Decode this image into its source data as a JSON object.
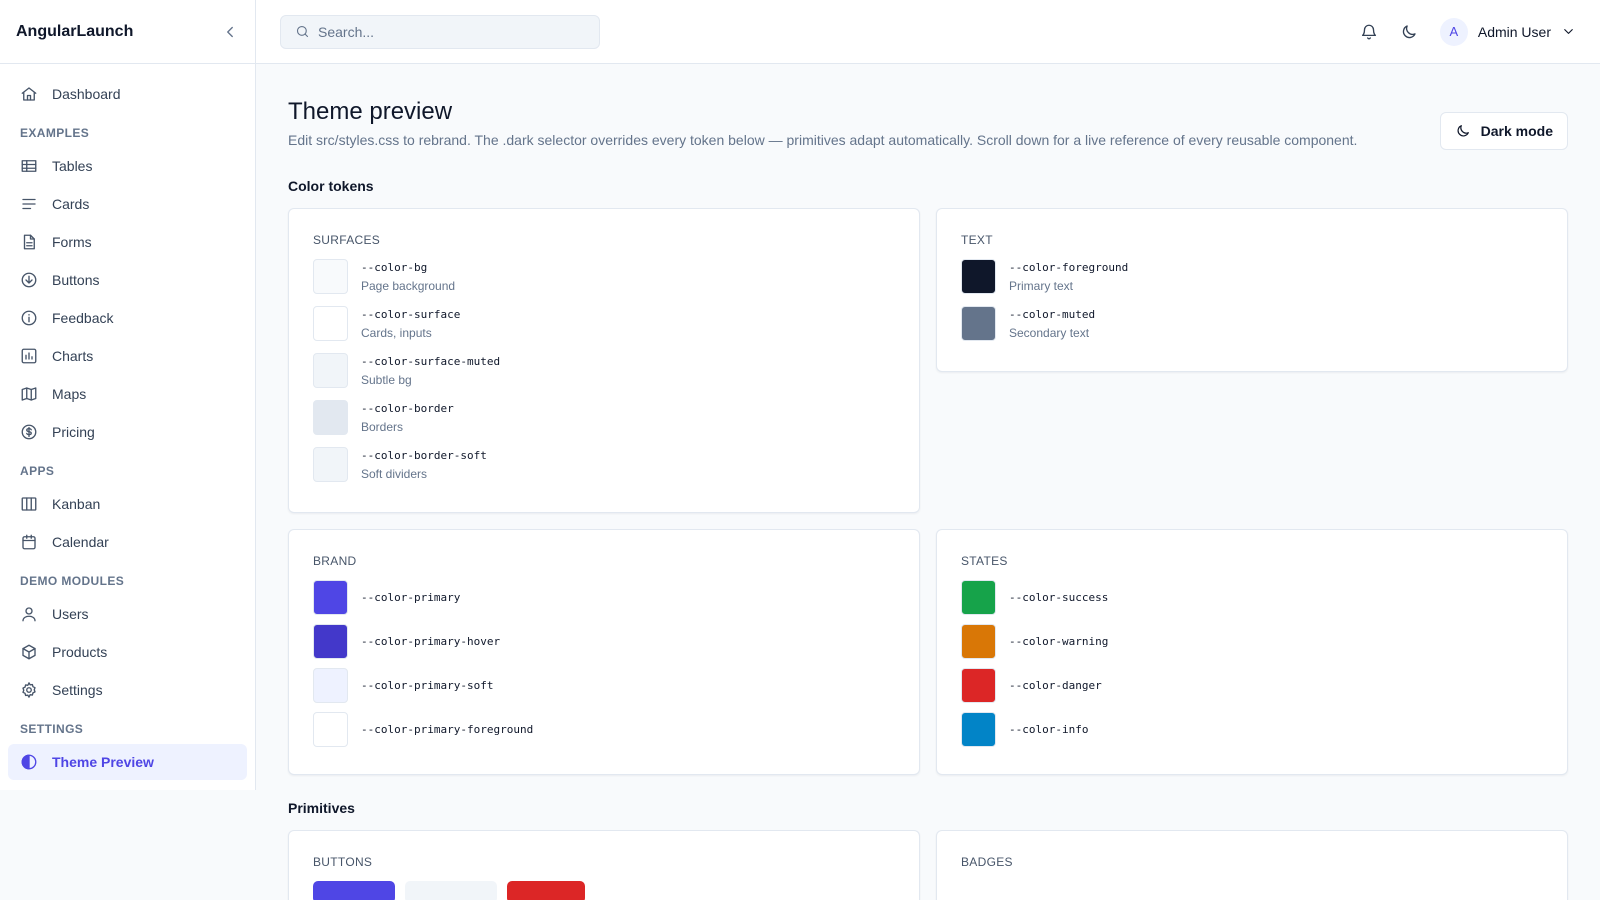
{
  "app": {
    "name": "AngularLaunch"
  },
  "sidebar": {
    "items": [
      {
        "label": "Dashboard",
        "icon": "home-icon"
      }
    ],
    "sections": [
      {
        "title": "EXAMPLES",
        "items": [
          {
            "label": "Tables",
            "icon": "table-icon"
          },
          {
            "label": "Cards",
            "icon": "lines-icon"
          },
          {
            "label": "Forms",
            "icon": "file-icon"
          },
          {
            "label": "Buttons",
            "icon": "arrow-down-circle-icon"
          },
          {
            "label": "Feedback",
            "icon": "info-icon"
          },
          {
            "label": "Charts",
            "icon": "bar-chart-icon"
          },
          {
            "label": "Maps",
            "icon": "map-icon"
          },
          {
            "label": "Pricing",
            "icon": "dollar-icon"
          }
        ]
      },
      {
        "title": "APPS",
        "items": [
          {
            "label": "Kanban",
            "icon": "kanban-icon"
          },
          {
            "label": "Calendar",
            "icon": "calendar-icon"
          }
        ]
      },
      {
        "title": "DEMO MODULES",
        "items": [
          {
            "label": "Users",
            "icon": "user-icon"
          },
          {
            "label": "Products",
            "icon": "box-icon"
          },
          {
            "label": "Settings",
            "icon": "gear-icon"
          }
        ]
      },
      {
        "title": "SETTINGS",
        "items": [
          {
            "label": "Theme Preview",
            "icon": "contrast-icon",
            "active": true
          }
        ]
      }
    ]
  },
  "topbar": {
    "search_placeholder": "Search...",
    "user": {
      "initial": "A",
      "name": "Admin User"
    }
  },
  "page": {
    "title": "Theme preview",
    "description": "Edit src/styles.css to rebrand. The .dark selector overrides every token below — primitives adapt automatically. Scroll down for a live reference of every reusable component.",
    "dark_mode_label": "Dark mode"
  },
  "color_tokens": {
    "title": "Color tokens",
    "surfaces": {
      "title": "SURFACES",
      "tokens": [
        {
          "name": "--color-bg",
          "desc": "Page background",
          "color": "#f8fafc"
        },
        {
          "name": "--color-surface",
          "desc": "Cards, inputs",
          "color": "#ffffff"
        },
        {
          "name": "--color-surface-muted",
          "desc": "Subtle bg",
          "color": "#f1f5f9"
        },
        {
          "name": "--color-border",
          "desc": "Borders",
          "color": "#e2e8f0"
        },
        {
          "name": "--color-border-soft",
          "desc": "Soft dividers",
          "color": "#f1f5f9"
        }
      ]
    },
    "text": {
      "title": "TEXT",
      "tokens": [
        {
          "name": "--color-foreground",
          "desc": "Primary text",
          "color": "#0f172a"
        },
        {
          "name": "--color-muted",
          "desc": "Secondary text",
          "color": "#64748b"
        }
      ]
    },
    "brand": {
      "title": "BRAND",
      "tokens": [
        {
          "name": "--color-primary",
          "color": "#4f46e5"
        },
        {
          "name": "--color-primary-hover",
          "color": "#4338ca"
        },
        {
          "name": "--color-primary-soft",
          "color": "#eef2ff"
        },
        {
          "name": "--color-primary-foreground",
          "color": "#ffffff"
        }
      ]
    },
    "states": {
      "title": "STATES",
      "tokens": [
        {
          "name": "--color-success",
          "color": "#16a34a"
        },
        {
          "name": "--color-warning",
          "color": "#d97706"
        },
        {
          "name": "--color-danger",
          "color": "#dc2626"
        },
        {
          "name": "--color-info",
          "color": "#0284c7"
        }
      ]
    }
  },
  "primitives": {
    "title": "Primitives",
    "buttons_title": "BUTTONS",
    "badges_title": "BADGES",
    "button_preview_colors": [
      "#4f46e5",
      "#f1f5f9",
      "#dc2626"
    ]
  }
}
